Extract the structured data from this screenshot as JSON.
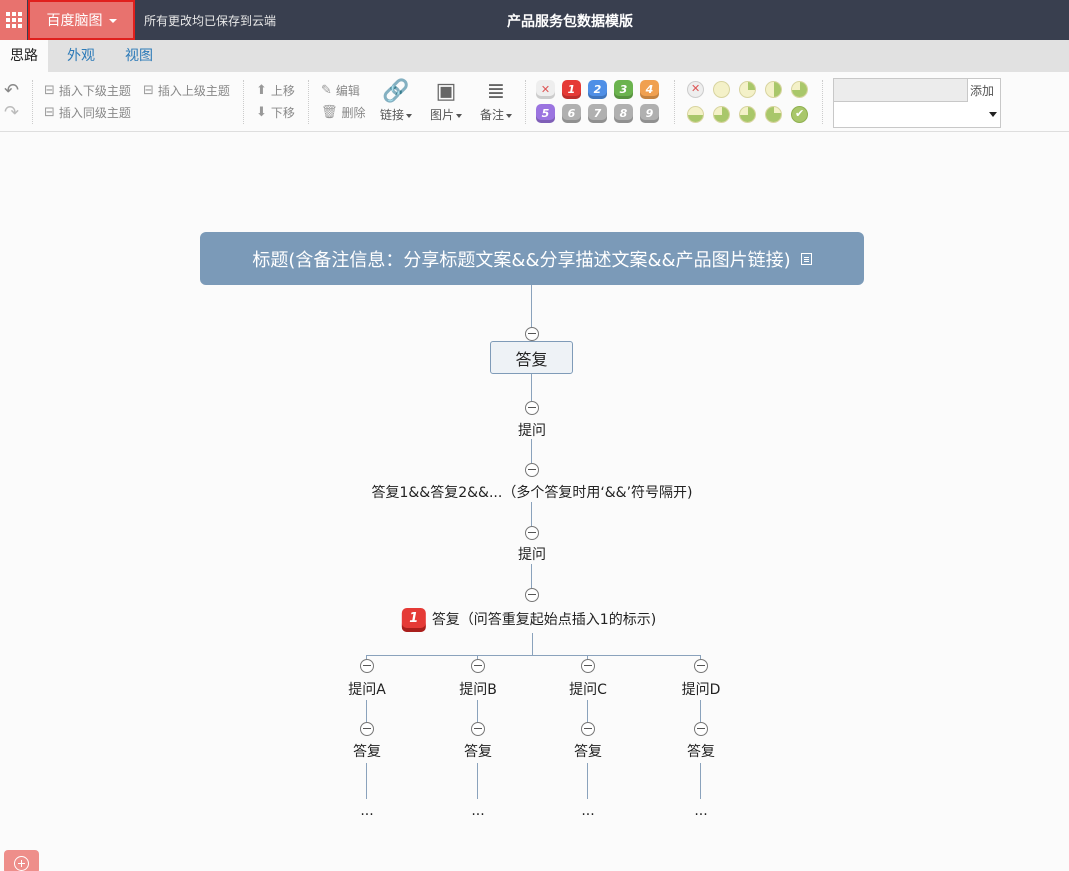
{
  "topbar": {
    "brand_label": "百度脑图",
    "save_status": "所有更改均已保存到云端",
    "doc_title": "产品服务包数据模版"
  },
  "tabs": [
    {
      "label": "思路"
    },
    {
      "label": "外观"
    },
    {
      "label": "视图"
    }
  ],
  "toolbar": {
    "insert_child": "插入下级主题",
    "insert_parent": "插入上级主题",
    "insert_sibling": "插入同级主题",
    "move_up": "上移",
    "move_down": "下移",
    "edit": "编辑",
    "delete": "删除",
    "link": "链接",
    "image": "图片",
    "note": "备注",
    "priorities": [
      "1",
      "2",
      "3",
      "4",
      "5",
      "6",
      "7",
      "8",
      "9"
    ],
    "priority_colors": [
      "#e53a36",
      "#4f8fe6",
      "#6bb34e",
      "#f0a050",
      "#9b74e0",
      "#b0b0b0",
      "#b0b0b0",
      "#b0b0b0",
      "#b0b0b0"
    ],
    "tag_add": "添加"
  },
  "mindmap": {
    "root": "标题(含备注信息：分享标题文案&&分享描述文案&&产品图片链接)",
    "main": "答复",
    "n1": "提问",
    "n2": "答复1&&答复2&&...（多个答复时用‘&&’符号隔开)",
    "n3": "提问",
    "n4_badge": "1",
    "n4": "答复（问答重复起始点插入1的标示)",
    "branches": [
      {
        "question": "提问A",
        "answer": "答复",
        "more": "..."
      },
      {
        "question": "提问B",
        "answer": "答复",
        "more": "..."
      },
      {
        "question": "提问C",
        "answer": "答复",
        "more": "..."
      },
      {
        "question": "提问D",
        "answer": "答复",
        "more": "..."
      }
    ]
  }
}
